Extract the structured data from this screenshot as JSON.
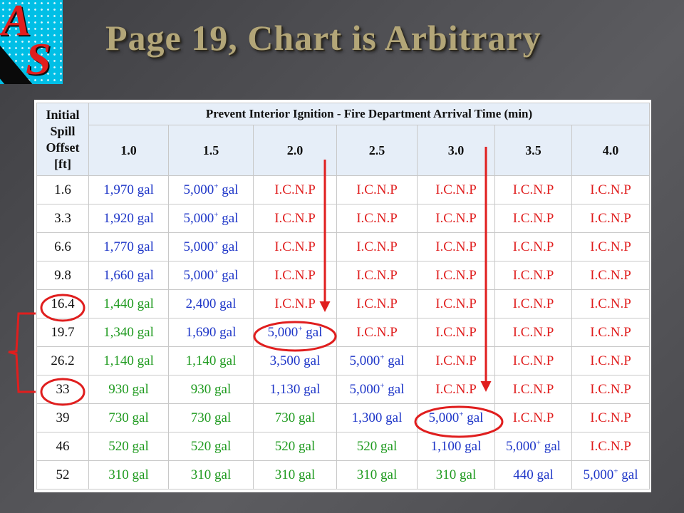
{
  "logo": {
    "letter_a": "A",
    "letter_s": "S"
  },
  "title": "Page 19, Chart is Arbitrary",
  "colors": {
    "gal_low": "#1e9a1e",
    "gal_high": "#1e36c8",
    "icnp": "#e01e1e",
    "annotation": "#e01e1e",
    "title": "#b3a678"
  },
  "table": {
    "corner_header": [
      "Initial",
      "Spill",
      "Offset",
      "[ft]"
    ],
    "group_header": "Prevent Interior Ignition - Fire Department Arrival Time (min)",
    "columns": [
      "1.0",
      "1.5",
      "2.0",
      "2.5",
      "3.0",
      "3.5",
      "4.0"
    ],
    "rows": [
      {
        "offset": "1.6",
        "cells": [
          {
            "text": "1,970 gal",
            "tone": "blue"
          },
          {
            "text": "5,000",
            "plus": true,
            "suffix": " gal",
            "tone": "blue"
          },
          {
            "text": "I.C.N.P",
            "tone": "red"
          },
          {
            "text": "I.C.N.P",
            "tone": "red"
          },
          {
            "text": "I.C.N.P",
            "tone": "red"
          },
          {
            "text": "I.C.N.P",
            "tone": "red"
          },
          {
            "text": "I.C.N.P",
            "tone": "red"
          }
        ]
      },
      {
        "offset": "3.3",
        "cells": [
          {
            "text": "1,920 gal",
            "tone": "blue"
          },
          {
            "text": "5,000",
            "plus": true,
            "suffix": " gal",
            "tone": "blue"
          },
          {
            "text": "I.C.N.P",
            "tone": "red"
          },
          {
            "text": "I.C.N.P",
            "tone": "red"
          },
          {
            "text": "I.C.N.P",
            "tone": "red"
          },
          {
            "text": "I.C.N.P",
            "tone": "red"
          },
          {
            "text": "I.C.N.P",
            "tone": "red"
          }
        ]
      },
      {
        "offset": "6.6",
        "cells": [
          {
            "text": "1,770 gal",
            "tone": "blue"
          },
          {
            "text": "5,000",
            "plus": true,
            "suffix": " gal",
            "tone": "blue"
          },
          {
            "text": "I.C.N.P",
            "tone": "red"
          },
          {
            "text": "I.C.N.P",
            "tone": "red"
          },
          {
            "text": "I.C.N.P",
            "tone": "red"
          },
          {
            "text": "I.C.N.P",
            "tone": "red"
          },
          {
            "text": "I.C.N.P",
            "tone": "red"
          }
        ]
      },
      {
        "offset": "9.8",
        "cells": [
          {
            "text": "1,660 gal",
            "tone": "blue"
          },
          {
            "text": "5,000",
            "plus": true,
            "suffix": " gal",
            "tone": "blue"
          },
          {
            "text": "I.C.N.P",
            "tone": "red"
          },
          {
            "text": "I.C.N.P",
            "tone": "red"
          },
          {
            "text": "I.C.N.P",
            "tone": "red"
          },
          {
            "text": "I.C.N.P",
            "tone": "red"
          },
          {
            "text": "I.C.N.P",
            "tone": "red"
          }
        ]
      },
      {
        "offset": "16.4",
        "cells": [
          {
            "text": "1,440 gal",
            "tone": "green"
          },
          {
            "text": "2,400 gal",
            "tone": "blue"
          },
          {
            "text": "I.C.N.P",
            "tone": "red"
          },
          {
            "text": "I.C.N.P",
            "tone": "red"
          },
          {
            "text": "I.C.N.P",
            "tone": "red"
          },
          {
            "text": "I.C.N.P",
            "tone": "red"
          },
          {
            "text": "I.C.N.P",
            "tone": "red"
          }
        ]
      },
      {
        "offset": "19.7",
        "cells": [
          {
            "text": "1,340 gal",
            "tone": "green"
          },
          {
            "text": "1,690 gal",
            "tone": "blue"
          },
          {
            "text": "5,000",
            "plus": true,
            "suffix": " gal",
            "tone": "blue"
          },
          {
            "text": "I.C.N.P",
            "tone": "red"
          },
          {
            "text": "I.C.N.P",
            "tone": "red"
          },
          {
            "text": "I.C.N.P",
            "tone": "red"
          },
          {
            "text": "I.C.N.P",
            "tone": "red"
          }
        ]
      },
      {
        "offset": "26.2",
        "cells": [
          {
            "text": "1,140 gal",
            "tone": "green"
          },
          {
            "text": "1,140 gal",
            "tone": "green"
          },
          {
            "text": "3,500 gal",
            "tone": "blue"
          },
          {
            "text": "5,000",
            "plus": true,
            "suffix": " gal",
            "tone": "blue"
          },
          {
            "text": "I.C.N.P",
            "tone": "red"
          },
          {
            "text": "I.C.N.P",
            "tone": "red"
          },
          {
            "text": "I.C.N.P",
            "tone": "red"
          }
        ]
      },
      {
        "offset": "33",
        "cells": [
          {
            "text": "930 gal",
            "tone": "green"
          },
          {
            "text": "930 gal",
            "tone": "green"
          },
          {
            "text": "1,130 gal",
            "tone": "blue"
          },
          {
            "text": "5,000",
            "plus": true,
            "suffix": " gal",
            "tone": "blue"
          },
          {
            "text": "I.C.N.P",
            "tone": "red"
          },
          {
            "text": "I.C.N.P",
            "tone": "red"
          },
          {
            "text": "I.C.N.P",
            "tone": "red"
          }
        ]
      },
      {
        "offset": "39",
        "cells": [
          {
            "text": "730 gal",
            "tone": "green"
          },
          {
            "text": "730 gal",
            "tone": "green"
          },
          {
            "text": "730 gal",
            "tone": "green"
          },
          {
            "text": "1,300 gal",
            "tone": "blue"
          },
          {
            "text": "5,000",
            "plus": true,
            "suffix": " gal",
            "tone": "blue"
          },
          {
            "text": "I.C.N.P",
            "tone": "red"
          },
          {
            "text": "I.C.N.P",
            "tone": "red"
          }
        ]
      },
      {
        "offset": "46",
        "cells": [
          {
            "text": "520 gal",
            "tone": "green"
          },
          {
            "text": "520 gal",
            "tone": "green"
          },
          {
            "text": "520 gal",
            "tone": "green"
          },
          {
            "text": "520 gal",
            "tone": "green"
          },
          {
            "text": "1,100 gal",
            "tone": "blue"
          },
          {
            "text": "5,000",
            "plus": true,
            "suffix": " gal",
            "tone": "blue"
          },
          {
            "text": "I.C.N.P",
            "tone": "red"
          }
        ]
      },
      {
        "offset": "52",
        "cells": [
          {
            "text": "310 gal",
            "tone": "green"
          },
          {
            "text": "310 gal",
            "tone": "green"
          },
          {
            "text": "310 gal",
            "tone": "green"
          },
          {
            "text": "310 gal",
            "tone": "green"
          },
          {
            "text": "310 gal",
            "tone": "green"
          },
          {
            "text": "440 gal",
            "tone": "blue"
          },
          {
            "text": "5,000",
            "plus": true,
            "suffix": " gal",
            "tone": "blue"
          }
        ]
      }
    ]
  },
  "annotations": {
    "circled_offsets": [
      "16.4",
      "33"
    ],
    "circled_cells": [
      {
        "offset": "19.7",
        "column": "2.0"
      },
      {
        "offset": "39",
        "column": "3.0"
      }
    ],
    "arrows": [
      {
        "column": "2.0",
        "to_offset": "16.4"
      },
      {
        "column": "3.0",
        "to_offset": "33"
      }
    ],
    "bracket_offsets": [
      "16.4",
      "33"
    ]
  }
}
